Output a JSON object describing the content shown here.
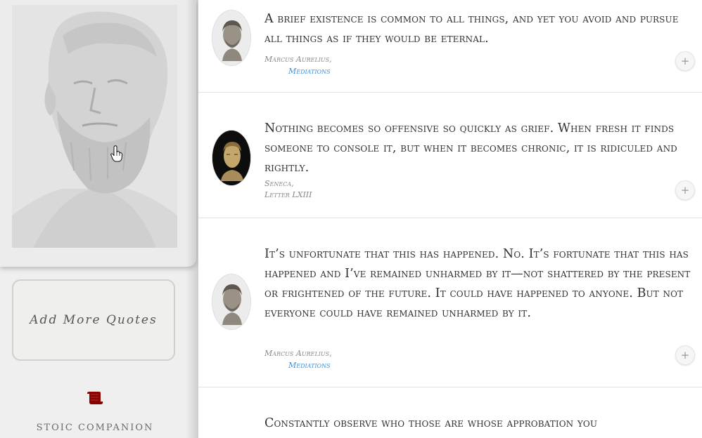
{
  "sidebar": {
    "add_button_label": "Add More Quotes",
    "brand": "STOIC COMPANION",
    "icons": {
      "portrait": "stoic-bust-portrait",
      "cursor": "hand-pointer-icon",
      "scroll": "scroll-icon"
    },
    "colors": {
      "scroll": "#8b0000",
      "sidebar_bg": "#efefef"
    }
  },
  "quotes": [
    {
      "text": "A brief existence is common to all things, and yet you avoid and pursue all things as if they would be eternal.",
      "author": "Marcus Aurelius,",
      "work": "Mediations",
      "avatar": "marcus-aurelius-bust",
      "plus": "+"
    },
    {
      "text": "Nothing becomes so offensive so quickly as grief. When fresh it finds someone to console it, but when it becomes chronic, it is ridiculed and rightly.",
      "author": "Seneca,",
      "work": "Letter LXIII",
      "avatar": "seneca-bust",
      "plus": "+"
    },
    {
      "text": "It’s unfortunate that this has happened. No. It’s fortunate that this has happened and I’ve remained unharmed by it—not shattered by the present or frightened of the future. It could have happened to anyone. But not everyone could have remained unharmed by it.",
      "author": "Marcus Aurelius,",
      "work": "Mediations",
      "avatar": "marcus-aurelius-bust",
      "plus": "+"
    },
    {
      "text": "Constantly observe who those are whose approbation you",
      "avatar": "marcus-aurelius-bust"
    }
  ],
  "colors": {
    "link": "#3f8fd6",
    "quote_text": "#333333",
    "meta": "#888888"
  }
}
